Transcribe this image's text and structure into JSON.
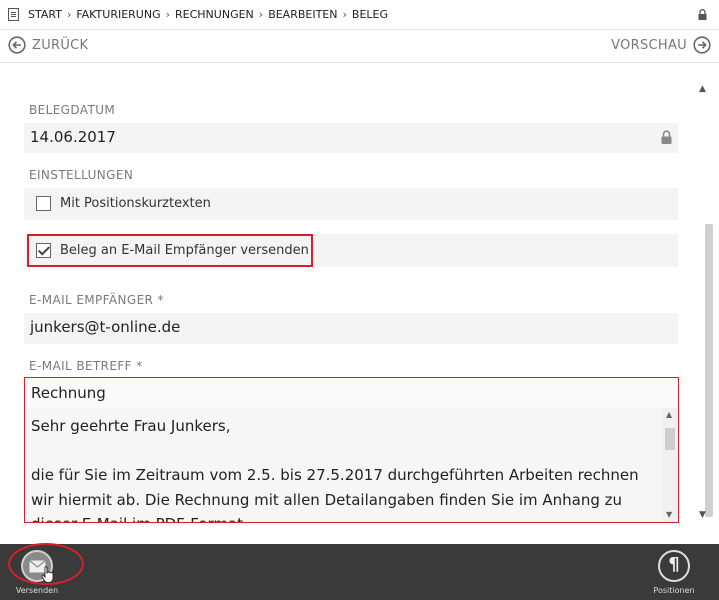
{
  "breadcrumb": {
    "items": [
      "START",
      "FAKTURIERUNG",
      "RECHNUNGEN",
      "BEARBEITEN",
      "BELEG"
    ],
    "separator": "›"
  },
  "nav": {
    "back_label": "ZURÜCK",
    "forward_label": "VORSCHAU"
  },
  "form": {
    "belegdatum_label": "BELEGDATUM",
    "belegdatum_value": "14.06.2017",
    "einstellungen_label": "EINSTELLUNGEN",
    "option_kurztexte_label": "Mit Positionskurztexten",
    "option_kurztexte_checked": false,
    "option_email_label": "Beleg an E-Mail Empfänger versenden",
    "option_email_checked": true,
    "empfaenger_label": "E-MAIL EMPFÄNGER *",
    "empfaenger_value": "junkers@t-online.de",
    "betreff_label": "E-MAIL BETREFF *",
    "betreff_value": "Rechnung",
    "body_text": "Sehr geehrte Frau Junkers,\n\ndie für Sie im Zeitraum vom 2.5. bis 27.5.2017 durchgeführten Arbeiten rechnen wir hiermit ab. Die Rechnung mit allen Detailangaben finden Sie im Anhang zu dieser E-Mail im PDF-Format."
  },
  "toolbar": {
    "send_label": "Versenden",
    "positions_label": "Positionen"
  },
  "colors": {
    "highlight": "#d4202c",
    "valid_border": "#7cb342",
    "bottom_bar": "#3a3a3a"
  },
  "icons": {
    "breadcrumb": "document-icon",
    "top_right": "lock-icon",
    "back": "arrow-left-circle-icon",
    "forward": "arrow-right-circle-icon",
    "date_field": "lock-icon",
    "send": "envelope-icon",
    "positions": "pilcrow-icon"
  }
}
